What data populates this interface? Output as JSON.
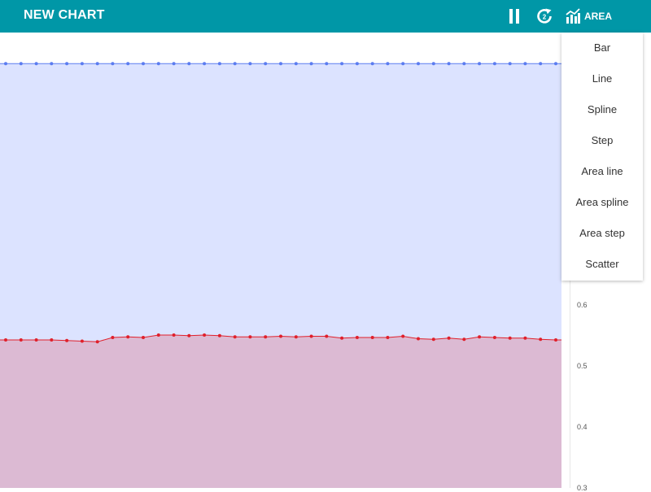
{
  "header": {
    "title": "NEW CHART",
    "chart_type_label": "AREA"
  },
  "icons": {
    "pause": "pause-icon",
    "refresh": "refresh-icon",
    "chart_type": "bar-chart-icon"
  },
  "colors": {
    "header_bg": "#0097a7",
    "series_top": "#5b7cf0",
    "series_top_fill": "#dce3ff",
    "series_bottom": "#e0202b",
    "series_bottom_fill": "#dcbad3"
  },
  "chart_type_menu": {
    "items": [
      "Bar",
      "Line",
      "Spline",
      "Step",
      "Area line",
      "Area spline",
      "Area step",
      "Scatter"
    ]
  },
  "chart_data": {
    "type": "area",
    "yaxis_ticks": [
      "0.6",
      "0.5",
      "0.4",
      "0.3"
    ],
    "series": [
      {
        "values": [
          0.997,
          0.997,
          0.997,
          0.997,
          0.997,
          0.997,
          0.997,
          0.997,
          0.997,
          0.997,
          0.997,
          0.997,
          0.997,
          0.997,
          0.997,
          0.997,
          0.997,
          0.997,
          0.997,
          0.997,
          0.997,
          0.997,
          0.997,
          0.997,
          0.997,
          0.997,
          0.997,
          0.997,
          0.997,
          0.997,
          0.997,
          0.997,
          0.997,
          0.997,
          0.997,
          0.997,
          0.997
        ]
      },
      {
        "values": [
          0.544,
          0.544,
          0.544,
          0.544,
          0.543,
          0.542,
          0.541,
          0.548,
          0.549,
          0.548,
          0.552,
          0.552,
          0.551,
          0.552,
          0.551,
          0.549,
          0.549,
          0.549,
          0.55,
          0.549,
          0.55,
          0.55,
          0.547,
          0.548,
          0.548,
          0.548,
          0.55,
          0.546,
          0.545,
          0.547,
          0.545,
          0.549,
          0.548,
          0.547,
          0.547,
          0.545,
          0.544
        ]
      }
    ]
  }
}
